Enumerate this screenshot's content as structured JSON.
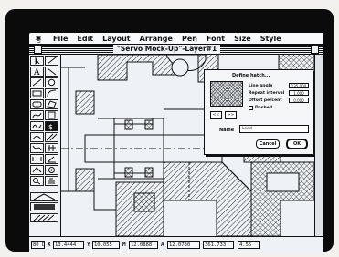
{
  "menubar": {
    "apple_icon": "apple-icon",
    "items": [
      "File",
      "Edit",
      "Layout",
      "Arrange",
      "Pen",
      "Font",
      "Size",
      "Style"
    ]
  },
  "window": {
    "title": "\"Servo Mock-Up\"-Layer#1"
  },
  "dialog": {
    "title": "Define hatch...",
    "line_angle_label": "Line angle",
    "line_angle_value": "135.000",
    "repeat_interval_label": "Repeat interval",
    "repeat_interval_value": "1.000",
    "offset_percent_label": "Offset percent",
    "offset_percent_value": "0.000",
    "dashed_label": "Dashed",
    "prev_label": "<<",
    "next_label": ">>",
    "name_label": "Name",
    "name_value": "Lead",
    "cancel_label": "Cancel",
    "ok_label": "OK"
  },
  "status": {
    "zoom": "80 D",
    "x_label": "X",
    "x_value": "13.4444",
    "y_label": "Y",
    "y_value": "10.055",
    "m_label": "M",
    "m_value": "12.0888",
    "a_label": "A",
    "a_value": "12.0780",
    "b_label": "B",
    "b_value": "361.733",
    "c_value": "4.55"
  },
  "colors": {
    "screen": "#eef2f6",
    "ink": "#111111",
    "bezel": "#0b0b0b"
  }
}
